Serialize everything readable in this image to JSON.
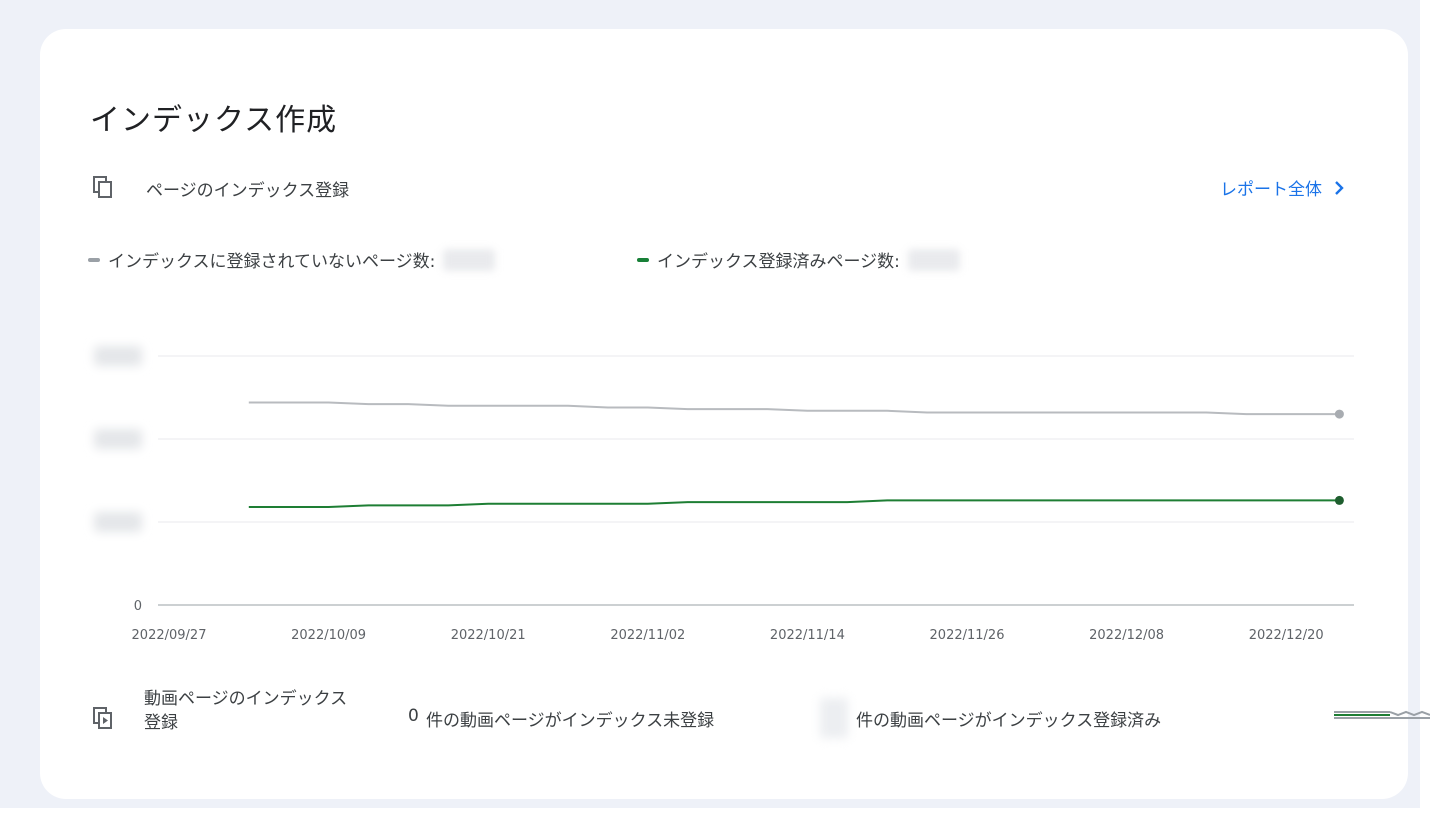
{
  "card": {
    "title": "インデックス作成",
    "page_indexing": {
      "label": "ページのインデックス登録",
      "icon": "copy-pages-icon",
      "report_link": "レポート全体",
      "report_icon": "chevron-right-icon"
    },
    "legend": [
      {
        "label": "インデックスに登録されていないページ数:",
        "color": "#9aa0a6"
      },
      {
        "label": "インデックス登録済みページ数:",
        "color": "#188038"
      }
    ],
    "video_indexing": {
      "icon": "video-page-icon",
      "label_line1": "動画ページのインデックス",
      "label_line2": "登録",
      "not_indexed_count": "0",
      "not_indexed_text": "件の動画ページがインデックス未登録",
      "indexed_text": "件の動画ページがインデックス登録済み"
    }
  },
  "chart_data": {
    "type": "line",
    "x_ticks": [
      "2022/09/27",
      "2022/10/09",
      "2022/10/21",
      "2022/11/02",
      "2022/11/14",
      "2022/11/26",
      "2022/12/08",
      "2022/12/20"
    ],
    "y_ticks_visible": [
      "0"
    ],
    "ylim": [
      0,
      1.5
    ],
    "grid": true,
    "series": [
      {
        "name": "インデックスに登録されていないページ数",
        "color": "#b8bbbf",
        "x": [
          "2022/10/03",
          "2022/10/06",
          "2022/10/09",
          "2022/10/12",
          "2022/10/15",
          "2022/10/18",
          "2022/10/21",
          "2022/10/24",
          "2022/10/27",
          "2022/10/30",
          "2022/11/02",
          "2022/11/05",
          "2022/11/08",
          "2022/11/11",
          "2022/11/14",
          "2022/11/17",
          "2022/11/20",
          "2022/11/23",
          "2022/11/26",
          "2022/11/29",
          "2022/12/02",
          "2022/12/05",
          "2022/12/08",
          "2022/12/11",
          "2022/12/14",
          "2022/12/17",
          "2022/12/20",
          "2022/12/24"
        ],
        "values": [
          1.22,
          1.22,
          1.22,
          1.21,
          1.21,
          1.2,
          1.2,
          1.2,
          1.2,
          1.19,
          1.19,
          1.18,
          1.18,
          1.18,
          1.17,
          1.17,
          1.17,
          1.16,
          1.16,
          1.16,
          1.16,
          1.16,
          1.16,
          1.16,
          1.16,
          1.15,
          1.15,
          1.15
        ]
      },
      {
        "name": "インデックス登録済みページ数",
        "color": "#1e7e34",
        "x": [
          "2022/10/03",
          "2022/10/06",
          "2022/10/09",
          "2022/10/12",
          "2022/10/15",
          "2022/10/18",
          "2022/10/21",
          "2022/10/24",
          "2022/10/27",
          "2022/10/30",
          "2022/11/02",
          "2022/11/05",
          "2022/11/08",
          "2022/11/11",
          "2022/11/14",
          "2022/11/17",
          "2022/11/20",
          "2022/11/23",
          "2022/11/26",
          "2022/11/29",
          "2022/12/02",
          "2022/12/05",
          "2022/12/08",
          "2022/12/11",
          "2022/12/14",
          "2022/12/17",
          "2022/12/20",
          "2022/12/24"
        ],
        "values": [
          0.59,
          0.59,
          0.59,
          0.6,
          0.6,
          0.6,
          0.61,
          0.61,
          0.61,
          0.61,
          0.61,
          0.62,
          0.62,
          0.62,
          0.62,
          0.62,
          0.63,
          0.63,
          0.63,
          0.63,
          0.63,
          0.63,
          0.63,
          0.63,
          0.63,
          0.63,
          0.63,
          0.63
        ]
      }
    ]
  }
}
